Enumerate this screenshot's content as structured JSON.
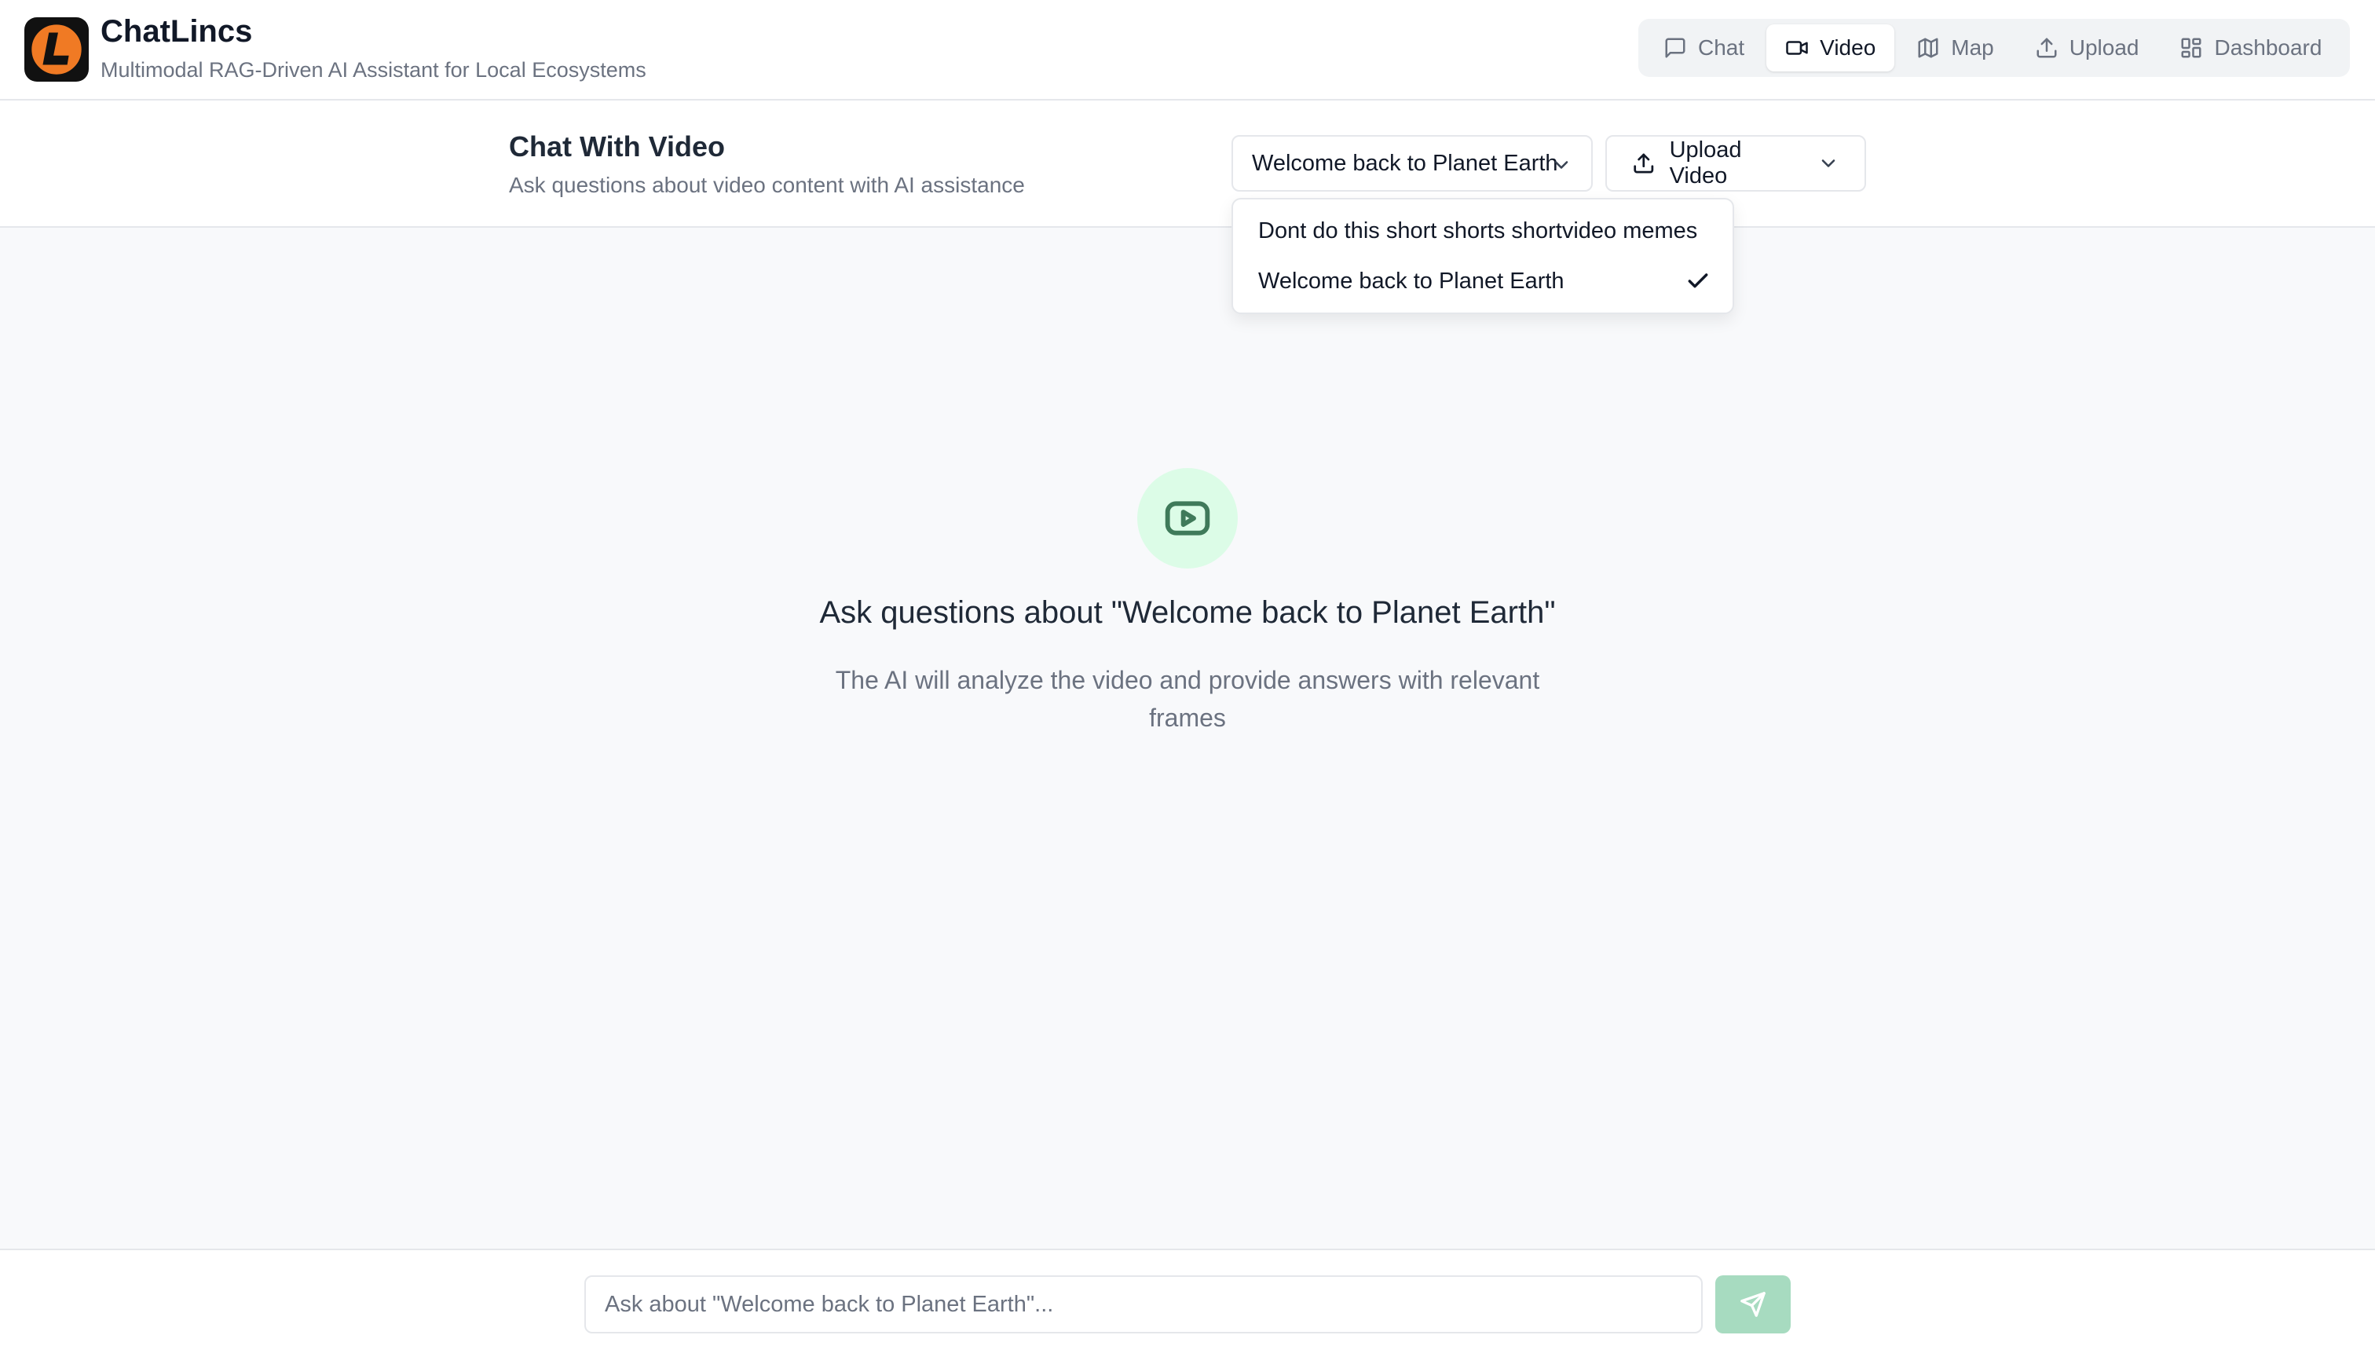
{
  "app": {
    "title": "ChatLincs",
    "subtitle": "Multimodal RAG-Driven AI Assistant for Local Ecosystems",
    "logo_letter": "L",
    "logo_accent": "#f07a24"
  },
  "nav": {
    "items": [
      {
        "label": "Chat",
        "icon": "chat-bubble-icon",
        "active": false
      },
      {
        "label": "Video",
        "icon": "video-camera-icon",
        "active": true
      },
      {
        "label": "Map",
        "icon": "map-icon",
        "active": false
      },
      {
        "label": "Upload",
        "icon": "upload-icon",
        "active": false
      },
      {
        "label": "Dashboard",
        "icon": "dashboard-grid-icon",
        "active": false
      }
    ]
  },
  "page": {
    "title": "Chat With Video",
    "subtitle": "Ask questions about video content with AI assistance"
  },
  "video_select": {
    "selected": "Welcome back to Planet Earth",
    "icon": "chevron-down-icon",
    "options": [
      {
        "label": "Dont do this short shorts shortvideo memes",
        "selected": false
      },
      {
        "label": "Welcome back to Planet Earth",
        "selected": true
      }
    ]
  },
  "upload_button": {
    "label": "Upload Video",
    "icon": "upload-icon"
  },
  "empty_state": {
    "icon": "play-video-icon",
    "title": "Ask questions about \"Welcome back to Planet Earth\"",
    "description": "The AI will analyze the video and provide answers with relevant frames"
  },
  "chat_input": {
    "value": "",
    "placeholder": "Ask about \"Welcome back to Planet Earth\"...",
    "send_icon": "send-icon"
  },
  "colors": {
    "accent_green": "#a7dbc0",
    "icon_bg": "#dcfce7",
    "icon_stroke": "#3f7a5a"
  }
}
